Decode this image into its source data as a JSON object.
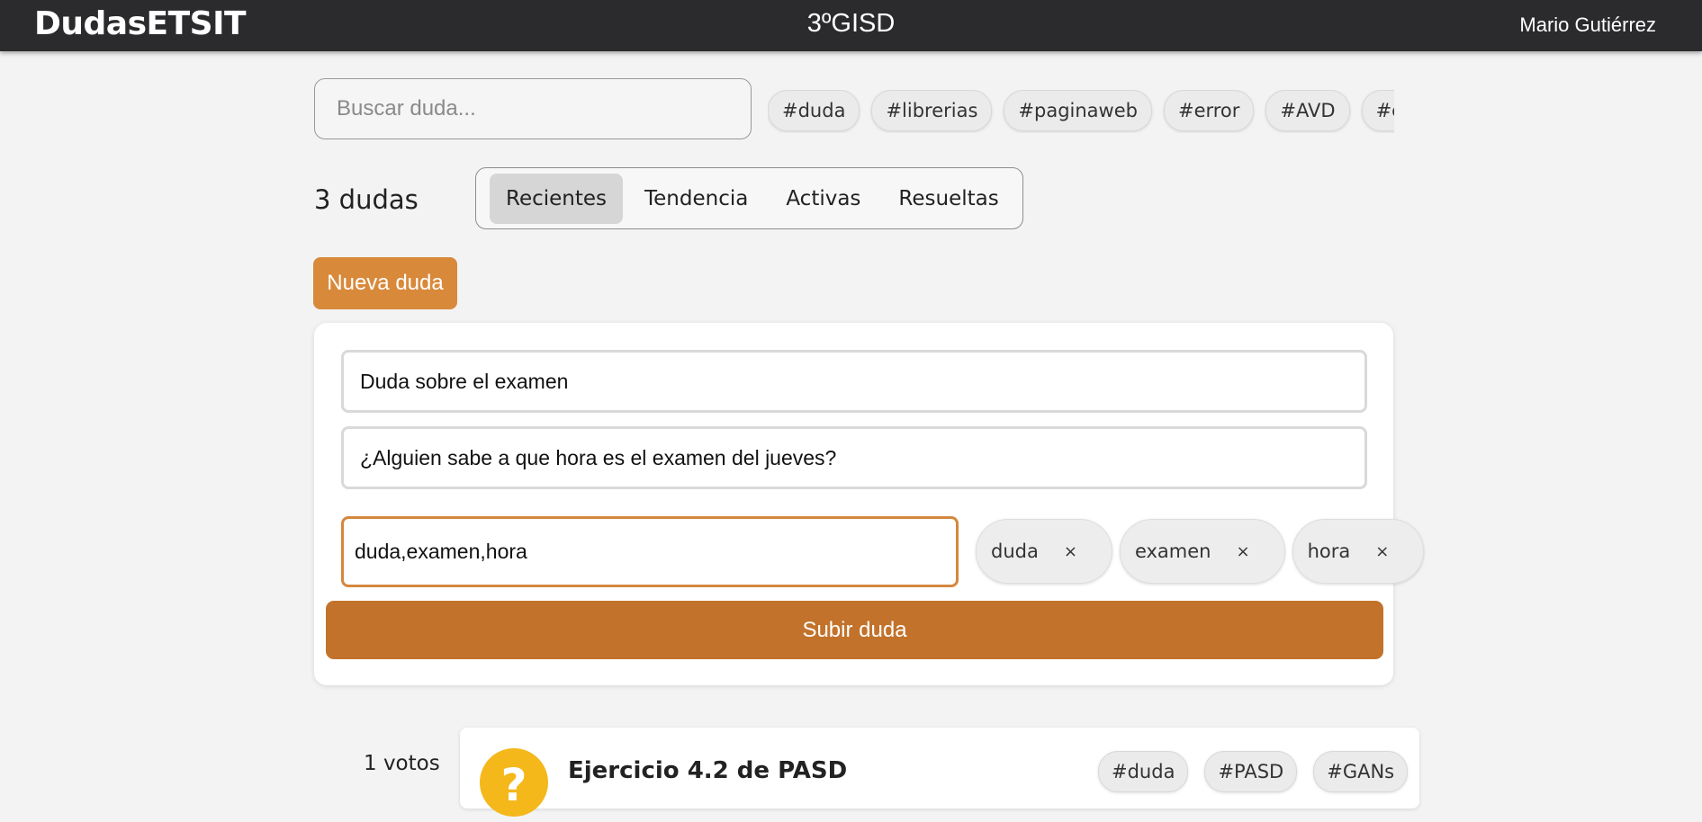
{
  "header": {
    "brand": "DudasETSIT",
    "course": "3ºGISD",
    "user": "Mario Gutiérrez"
  },
  "search": {
    "placeholder": "Buscar duda...",
    "value": ""
  },
  "tag_filters": [
    "#duda",
    "#librerias",
    "#paginaweb",
    "#error",
    "#AVD",
    "#examen"
  ],
  "count_label": "3 dudas",
  "tabs": [
    {
      "label": "Recientes",
      "active": true
    },
    {
      "label": "Tendencia",
      "active": false
    },
    {
      "label": "Activas",
      "active": false
    },
    {
      "label": "Resueltas",
      "active": false
    }
  ],
  "new_button": "Nueva duda",
  "form": {
    "title_value": "Duda sobre el examen",
    "body_value": "¿Alguien sabe a que hora es el examen del jueves?",
    "tags_value": "duda,examen,hora",
    "selected_tags": [
      {
        "label": "duda",
        "remove": "×"
      },
      {
        "label": "examen",
        "remove": "×"
      },
      {
        "label": "hora",
        "remove": "×"
      }
    ],
    "submit_label": "Subir duda"
  },
  "question": {
    "votes": "1 votos",
    "icon": "question-icon",
    "icon_glyph": "?",
    "title": "Ejercicio 4.2 de PASD",
    "tags": [
      "#duda",
      "#PASD",
      "#GANs"
    ]
  },
  "colors": {
    "header_bg": "#2b2b2e",
    "accent": "#d9893a",
    "submit": "#c2722a",
    "question_icon": "#f4b81b"
  }
}
